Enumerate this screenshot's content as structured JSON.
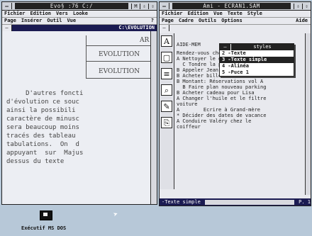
{
  "left_window": {
    "title": "Evo§ :76   C:/",
    "title_right": "M",
    "menu": [
      "Fichier",
      "Edition",
      "Vers",
      "Looke"
    ],
    "submenu": [
      "Page",
      "Insérer",
      "Outil",
      "Vue",
      "?"
    ],
    "path": "C:\\EVOLUTION",
    "box_labels": [
      "AR",
      "EVOLUTION",
      "EVOLUTION"
    ],
    "body_lines": [
      "     D'autres foncti",
      "d'évolution ce souc",
      "ainsi la possibili",
      "caractère de minusc",
      "sera beaucoup moins",
      "tracés des tableau",
      "tabulations.  On  d",
      "appuyant  sur  Majus",
      "dessus du texte"
    ]
  },
  "right_window": {
    "title": "Ami - ECRAN1.SAM",
    "menu": [
      "Fichier",
      "Edition",
      "Vue",
      "Texte",
      "Style"
    ],
    "submenu": [
      "Page",
      "Cadre",
      "Outils",
      "Options",
      "Aide"
    ],
    "tools": [
      "A",
      "▢",
      "≡",
      "⌕",
      "✎",
      "⎘"
    ],
    "heading": "AIDE-MEM",
    "lines": [
      "Rendez-vous chez le dentiste",
      "A Nettoyer le garage",
      "  C Tondre la pelouse",
      "B Appeler Jean-Louis",
      "B Acheter billets France-Gall",
      "B Montant: Réservations vol A",
      "  B Faire plan nouveau parking",
      "B Acheter cadeau pour Lisa",
      "A Changer l'huile et le filtre",
      "voiture",
      "A        Ecrire à Grand-mère",
      "* Décider des dates de vacance",
      "A Conduire Valéry chez le",
      "coiffeur"
    ],
    "styles_popup": {
      "title": "styles",
      "options": [
        "2 -Texte",
        "3 -Texte simple",
        "4 -Alinéa",
        "5 -Puce 1"
      ],
      "selected_index": 1
    },
    "status": {
      "style": "-Texte simple",
      "page": "P. 1"
    }
  },
  "desktop": {
    "icon_label": "Exécutif MS DOS"
  }
}
